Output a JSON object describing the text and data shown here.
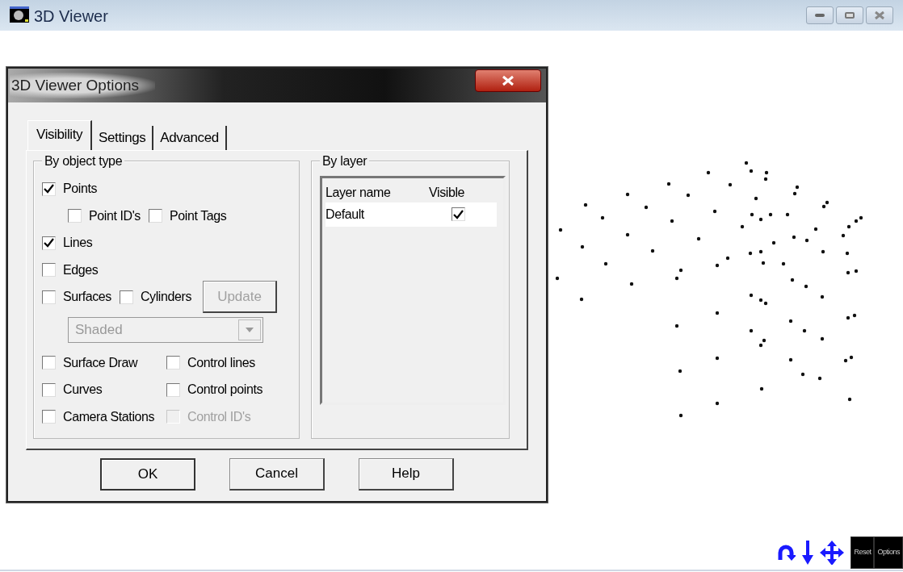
{
  "window": {
    "title": "3D Viewer"
  },
  "dialog": {
    "title": "3D Viewer Options",
    "tabs": [
      {
        "label": "Visibility",
        "selected": true
      },
      {
        "label": "Settings",
        "selected": false
      },
      {
        "label": "Advanced",
        "selected": false
      }
    ],
    "object_group": {
      "title": "By object type",
      "rows": [
        {
          "items": [
            {
              "kind": "checkbox",
              "label": "Points",
              "checked": true,
              "disabled": false,
              "children": [
                {
                  "kind": "checkbox",
                  "label": "Point ID's",
                  "checked": false,
                  "disabled": false
                },
                {
                  "kind": "checkbox",
                  "label": "Point Tags",
                  "checked": false,
                  "disabled": false
                }
              ]
            }
          ]
        },
        {
          "items": [
            {
              "kind": "checkbox",
              "label": "Lines",
              "checked": true,
              "disabled": false
            }
          ]
        },
        {
          "items": [
            {
              "kind": "checkbox",
              "label": "Edges",
              "checked": false,
              "disabled": false
            }
          ]
        },
        {
          "items": [
            {
              "kind": "checkbox",
              "label": "Surfaces",
              "checked": false,
              "disabled": false
            },
            {
              "kind": "checkbox",
              "label": "Cylinders",
              "checked": false,
              "disabled": false
            },
            {
              "kind": "button",
              "label": "Update",
              "disabled": true
            }
          ]
        },
        {
          "items": [
            {
              "kind": "select",
              "value": "Shaded",
              "disabled": true
            }
          ]
        },
        {
          "items": [
            {
              "kind": "checkbox",
              "label": "Surface Draw",
              "checked": false,
              "disabled": false
            },
            {
              "kind": "checkbox",
              "label": "Control lines",
              "checked": false,
              "disabled": false
            }
          ]
        },
        {
          "items": [
            {
              "kind": "checkbox",
              "label": "Curves",
              "checked": false,
              "disabled": false
            },
            {
              "kind": "checkbox",
              "label": "Control points",
              "checked": false,
              "disabled": false
            }
          ]
        },
        {
          "items": [
            {
              "kind": "checkbox",
              "label": "Camera Stations",
              "checked": false,
              "disabled": false
            },
            {
              "kind": "checkbox",
              "label": "Control ID's",
              "checked": false,
              "disabled": true
            }
          ]
        }
      ]
    },
    "layer_group": {
      "title": "By layer",
      "columns": [
        "Layer name",
        "Visible"
      ],
      "rows": [
        {
          "name": "Default",
          "visible": true
        }
      ]
    },
    "buttons": [
      "OK",
      "Cancel",
      "Help"
    ]
  },
  "toolbar": {
    "buttons": [
      "Reset",
      "Options"
    ]
  }
}
